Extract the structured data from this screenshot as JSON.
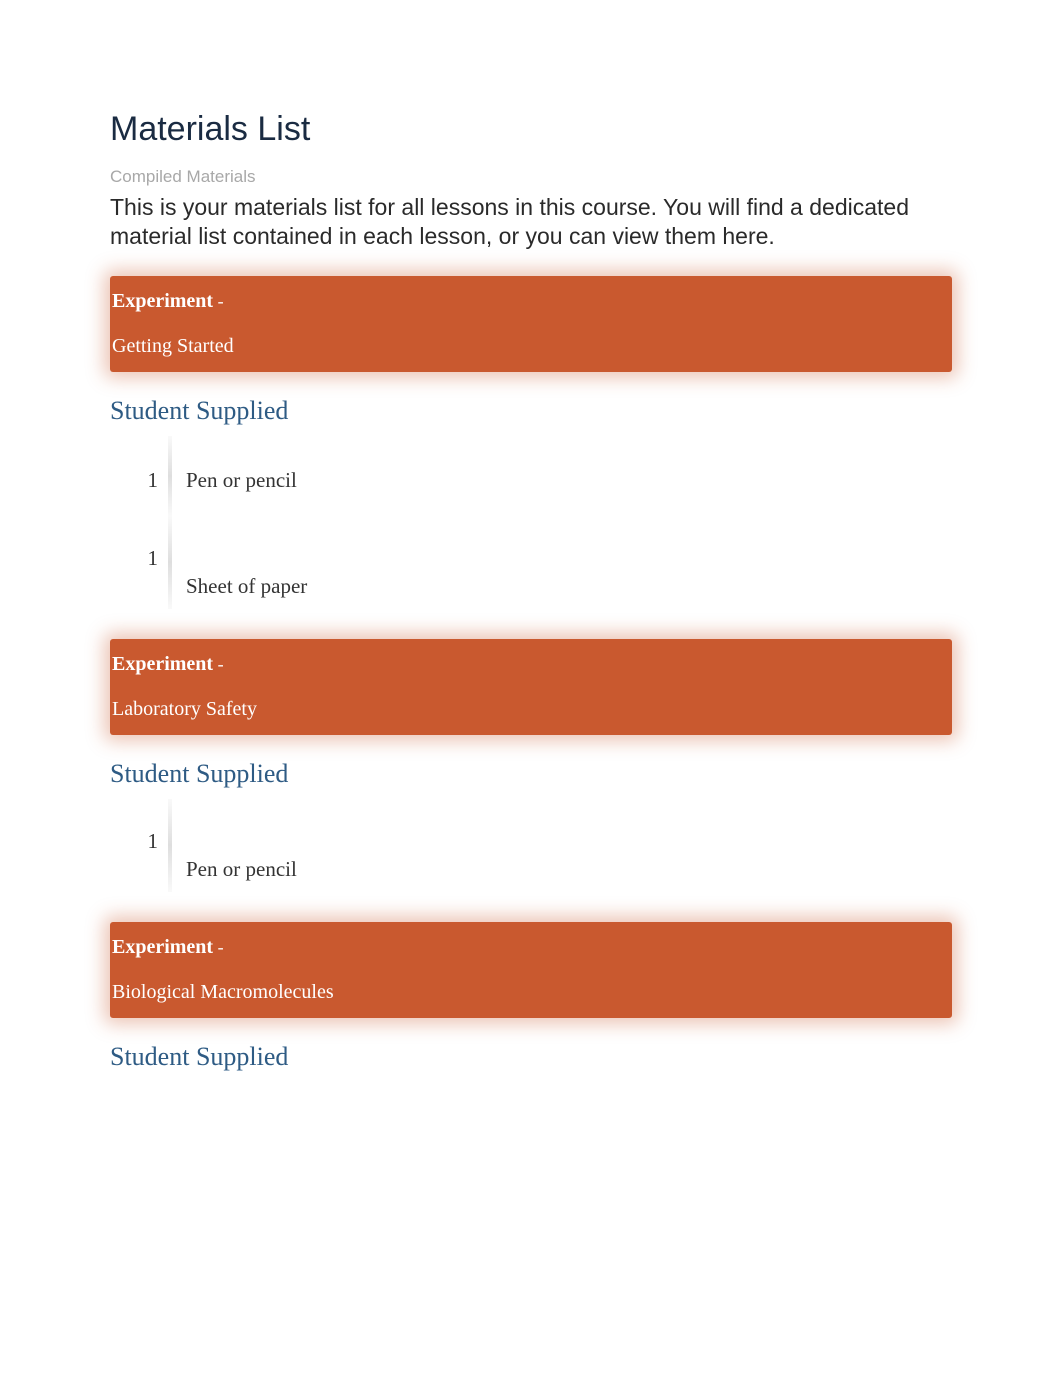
{
  "header": {
    "title": "Materials List",
    "subtitle": "Compiled Materials",
    "intro": "This is your materials list for all lessons in this course. You will find a dedicated material list contained in each lesson, or you can view them here."
  },
  "labels": {
    "experiment": "Experiment",
    "dash": " -",
    "student_supplied": "Student Supplied"
  },
  "sections": [
    {
      "experiment_name": "Getting Started",
      "items": [
        {
          "qty": "1",
          "name": "Pen or pencil"
        },
        {
          "qty": "1",
          "name": "Sheet of paper"
        }
      ]
    },
    {
      "experiment_name": "Laboratory Safety",
      "items": [
        {
          "qty": "1",
          "name": "Pen or pencil"
        }
      ]
    },
    {
      "experiment_name": "Biological Macromolecules",
      "items": []
    }
  ]
}
